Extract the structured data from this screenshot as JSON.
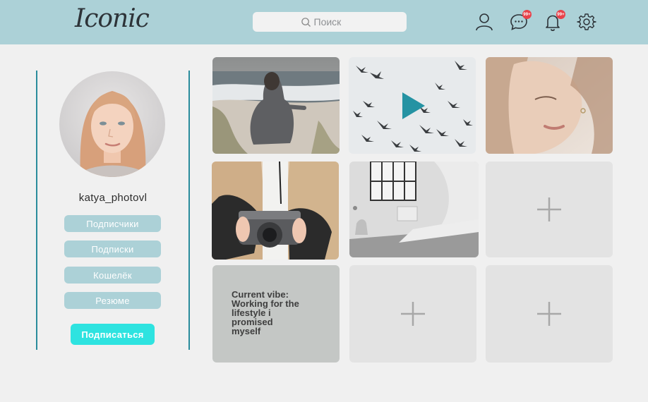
{
  "header": {
    "logo": "Iconic",
    "search_placeholder": "Поиск",
    "chat_badge": "99+",
    "notif_badge": "99+"
  },
  "profile": {
    "username": "katya_photovl",
    "buttons": [
      "Подписчики",
      "Подписки",
      "Кошелёк",
      "Резюме"
    ],
    "subscribe": "Подписаться"
  },
  "posts": {
    "text_post": "Current vibe: Working for the lifestyle i promised myself"
  },
  "colors": {
    "header_bg": "#acd1d7",
    "accent": "#2ee3e0",
    "divider": "#2a8c9c",
    "badge": "#e8424b"
  }
}
